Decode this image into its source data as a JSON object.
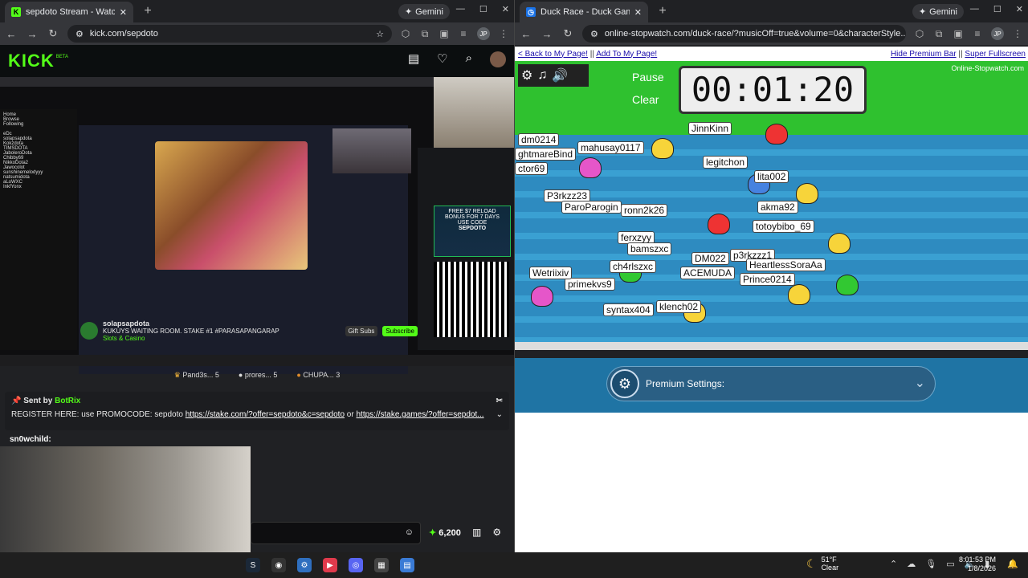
{
  "left": {
    "tab_title": "sepdoto Stream - Watch Li...",
    "url": "kick.com/sepdoto",
    "gemini": "Gemini",
    "profile": "JP",
    "kick": {
      "logo": "KICK",
      "beta": "BETA",
      "stream_name": "solapsapdota",
      "stream_title": "KUKUYS WAITING ROOM.  STAKE #1 #PARASAPANGARAP",
      "category": "Slots & Casino",
      "gift_subs": "Gift Subs",
      "subscribe": "Subscribe",
      "inner_sidebar": [
        "Home",
        "Browse",
        "Following"
      ],
      "inner_channels": [
        "eDc",
        "solapsapdota",
        "Kokzdota",
        "TIMSDOTA",
        "JaboleroDota",
        "Chibby69",
        "NikkoDota2",
        "Jawocolot",
        "sunshinemelodyyy",
        "natsumidota",
        "aLoWXC",
        "InkfYonx"
      ],
      "stake_ad": [
        "FREE $7 RELOAD",
        "BONUS FOR 7 DAYS",
        "USE CODE",
        "SEPDOTO"
      ],
      "badges": [
        {
          "label": "Pand3s...",
          "count": "5"
        },
        {
          "label": "prores...",
          "count": "5"
        },
        {
          "label": "CHUPA...",
          "count": "3"
        }
      ],
      "pinned_sender_prefix": "Sent by",
      "pinned_sender": "BotRix",
      "pinned_text": "REGISTER HERE: use PROMOCODE: sepdoto",
      "pinned_link1": "https://stake.com/?offer=sepdoto&c=sepdoto",
      "pinned_or": "or",
      "pinned_link2": "https://stake.games/?offer=sepdot...",
      "chat_user": "sn0wchild:",
      "points": "6,200"
    }
  },
  "right": {
    "tab_title": "Duck Race - Duck Games",
    "url": "online-stopwatch.com/duck-race/?musicOff=true&volume=0&characterStyle...",
    "gemini": "Gemini",
    "profile": "JP",
    "back_link": "< Back to My Page!",
    "sep": "||",
    "add_link": "Add To My Page!",
    "hide_link": "Hide Premium Bar",
    "full_link": "Super Fullscreen",
    "pause": "Pause",
    "clear": "Clear",
    "timer": "00:01:20",
    "site_badge": "Online-Stopwatch.com",
    "premium": "Premium Settings:",
    "names": [
      "JinnKinn",
      "dm0214",
      "mahusay0117",
      "ghtmareBind",
      "legitchon",
      "lita002",
      "ctor69",
      "P3rkzz23",
      "ParoParogin",
      "ronn2k26",
      "akma92",
      "totoybibo_69",
      "ferxzyy",
      "bamszxc",
      "DM022",
      "p3rkzzz1",
      "HeartlessSoraAa",
      "ACEMUDA",
      "Prince0214",
      "primekvs9",
      "syntax404",
      "klench02",
      "ch4rlszxc",
      "Wetriixiv"
    ]
  },
  "taskbar": {
    "temp": "51°F",
    "cond": "Clear",
    "time": "8:01:53 PM",
    "date": "1/8/2026"
  }
}
